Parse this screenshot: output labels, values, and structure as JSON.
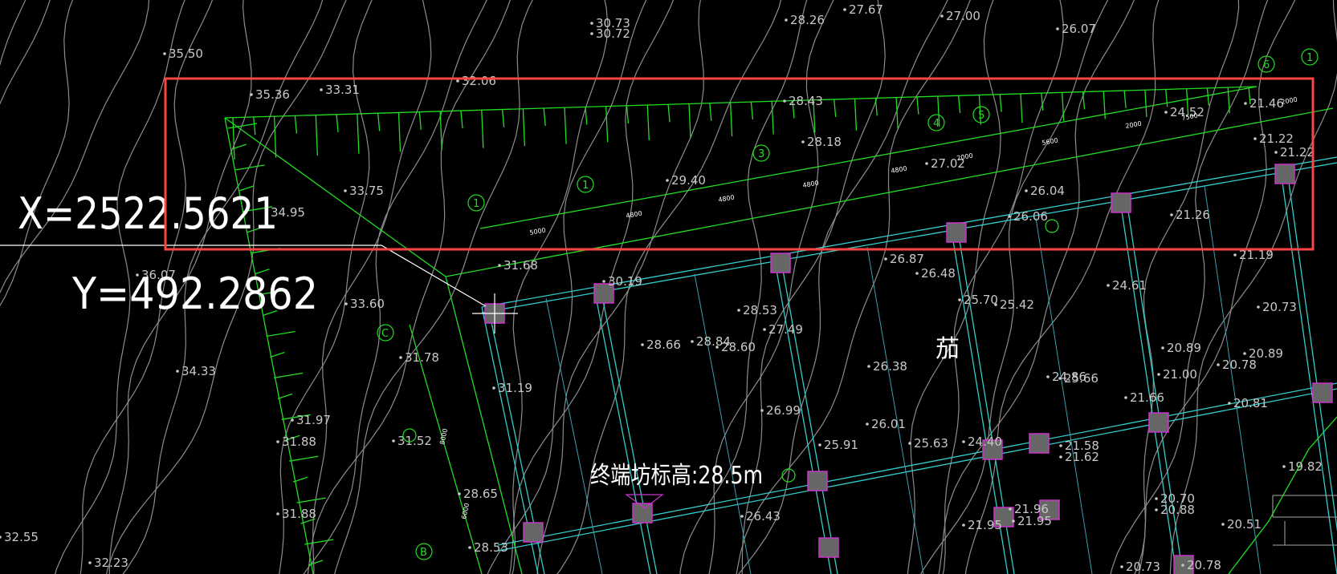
{
  "colors": {
    "background": "#000000",
    "contour": "#8c8c8c",
    "slope": "#22dd22",
    "beam": "#33cccc",
    "column_fill": "#666666",
    "column_stroke": "#cc33cc",
    "highlight": "#ff4444",
    "text": "#ffffff"
  },
  "coordinates": {
    "x_label": "X=2522.5621",
    "y_label": "Y=492.2862"
  },
  "annotation": {
    "terminal_elevation": "终端坊标高:28.5m",
    "vertical_char": "茄"
  },
  "dimensions": {
    "lower": [
      "5000",
      "4800",
      "4800",
      "4800",
      "4800",
      "2000",
      "5600",
      "2000"
    ],
    "upper": [
      "7500",
      "2000"
    ],
    "left": [
      "8000",
      "6000"
    ]
  },
  "axis_markers": {
    "top": [
      "1",
      "1",
      "3",
      "4",
      "5",
      "6",
      "1"
    ],
    "left": [
      "C",
      "B"
    ]
  },
  "elevations": [
    "35.50",
    "35.36",
    "33.31",
    "32.06",
    "30.73",
    "30.72",
    "28.26",
    "27.67",
    "27.00",
    "26.07",
    "28.43",
    "28.18",
    "29.40",
    "27.02",
    "26.04",
    "26.06",
    "24.52",
    "21.46",
    "21.22",
    "21.26",
    "33.75",
    "34.95",
    "36.07",
    "33.60",
    "31.68",
    "30.19",
    "26.87",
    "26.48",
    "25.70",
    "25.42",
    "24.61",
    "20.73",
    "28.53",
    "28.66",
    "28.84",
    "28.60",
    "27.49",
    "31.78",
    "34.33",
    "31.19",
    "26.38",
    "24.86",
    "25.66",
    "20.89",
    "20.78",
    "20.89",
    "21.00",
    "21.66",
    "20.81",
    "26.99",
    "26.01",
    "31.97",
    "31.88",
    "31.52",
    "25.91",
    "25.63",
    "24.40",
    "21.58",
    "21.62",
    "19.82",
    "28.65",
    "26.43",
    "21.95",
    "21.96",
    "21.95",
    "20.70",
    "20.88",
    "20.51",
    "31.88",
    "32.55",
    "32.23",
    "28.53",
    "20.73",
    "20.78",
    "21.19",
    "21.22"
  ]
}
